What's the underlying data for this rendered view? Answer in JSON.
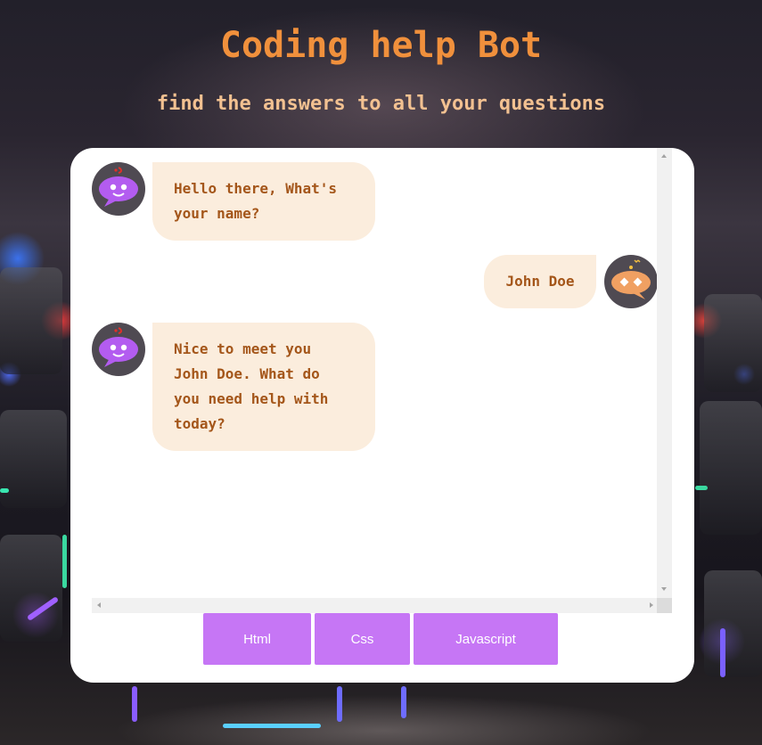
{
  "header": {
    "title": "Coding help Bot",
    "subtitle": "find the answers to all your questions"
  },
  "chat": {
    "messages": [
      {
        "sender": "bot",
        "text": "Hello there, What's your name?",
        "avatar_icon": "bot-chat-bubble-icon"
      },
      {
        "sender": "user",
        "text": "John Doe",
        "avatar_icon": "user-chat-bubble-icon"
      },
      {
        "sender": "bot",
        "text": "Nice to meet you John Doe. What do you need help with today?",
        "avatar_icon": "bot-chat-bubble-icon"
      }
    ]
  },
  "options": {
    "buttons": [
      {
        "label": "Html"
      },
      {
        "label": "Css"
      },
      {
        "label": "Javascript"
      }
    ]
  },
  "colors": {
    "title": "#f0903c",
    "subtitle": "#f2c191",
    "bubble_bg": "#fbeddd",
    "bubble_text": "#a4561a",
    "button_bg": "#c676f5",
    "avatar_bg": "#4f4a52",
    "bot_icon": "#b35cf0",
    "user_icon": "#f0a062"
  }
}
